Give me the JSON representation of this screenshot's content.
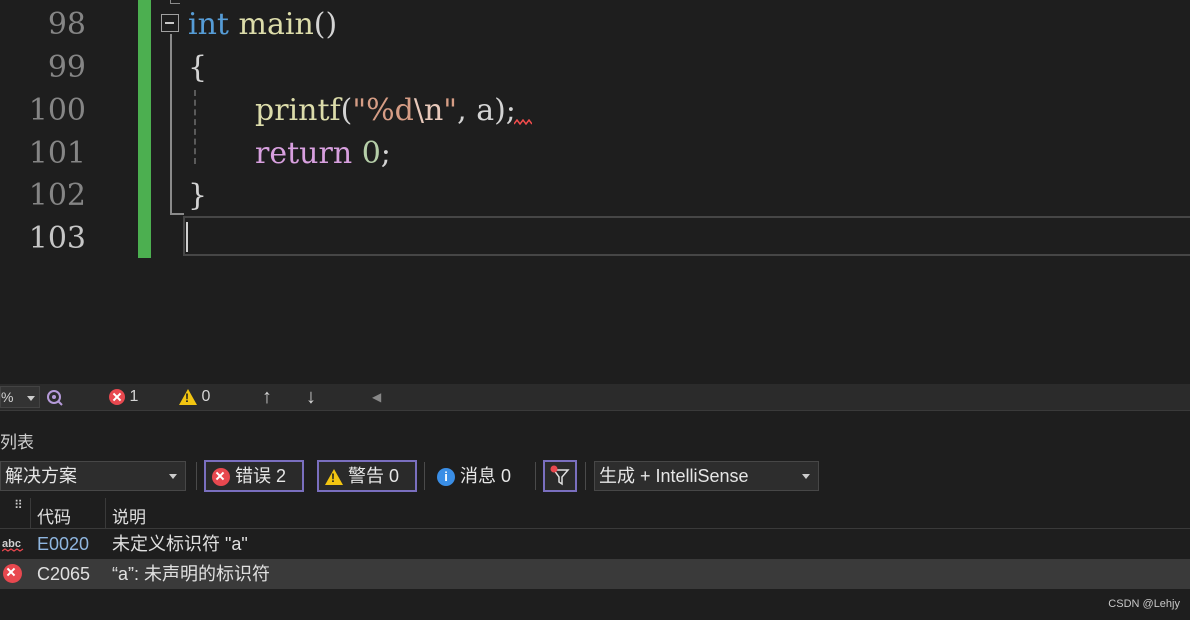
{
  "editor": {
    "line_numbers": [
      "98",
      "99",
      "100",
      "101",
      "102",
      "103"
    ],
    "line_98": {
      "kw": "int",
      "fn": "main",
      "rest": "()"
    },
    "line_99": "{",
    "line_100": {
      "fn": "printf",
      "open": "(",
      "str_start": "\"%d",
      "esc": "\\n",
      "str_end": "\"",
      "sep": ", ",
      "var": "a",
      "close": ");"
    },
    "line_101": {
      "kw": "return",
      "num": "0",
      "end": ";"
    },
    "line_102": "}"
  },
  "statusbar": {
    "zoom_partial": "%",
    "error_count": "1",
    "warning_count": "0",
    "up_arrow": "↑",
    "down_arrow": "↓",
    "left_arrow": "◀"
  },
  "error_list": {
    "title_partial": "列表",
    "scope_dropdown": "解决方案",
    "errors_label": "错误 2",
    "warnings_label": "警告 0",
    "messages_label": "消息 0",
    "source_dropdown": "生成 + IntelliSense",
    "columns": {
      "code": "代码",
      "description": "说明"
    },
    "rows": [
      {
        "icon": "spell-abc-icon",
        "code": "E0020",
        "description": "未定义标识符 \"a\""
      },
      {
        "icon": "error-icon",
        "code": "C2065",
        "description": "“a”: 未声明的标识符"
      }
    ]
  },
  "watermark": "CSDN @Lehjy",
  "colors": {
    "accent_green": "#4caf50",
    "error_red": "#e8484f",
    "warning_yellow": "#f2c511",
    "filter_border": "#7a6fbf"
  }
}
